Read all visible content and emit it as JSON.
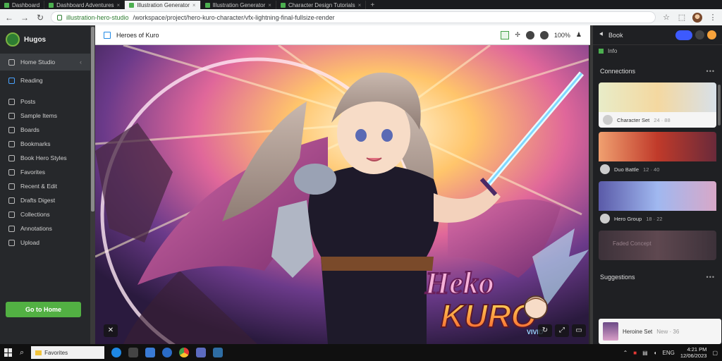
{
  "browser": {
    "tabs": [
      {
        "label": "Dashboard",
        "active": false
      },
      {
        "label": "Dashboard Adventures",
        "active": false
      },
      {
        "label": "Illustration Generator",
        "active": true
      },
      {
        "label": "Illustration Generator",
        "active": false
      },
      {
        "label": "Character Design Tutorials",
        "active": false
      }
    ],
    "new_tab": "+",
    "url_host": "illustration-hero-studio",
    "url_path": "/workspace/project/hero-kuro-character/vfx-lightning-final-fullsize-render",
    "nav": {
      "back": "←",
      "forward": "→",
      "reload": "↻"
    },
    "toolbar_icons": [
      "star-icon",
      "extension-icon",
      "profile-avatar"
    ]
  },
  "sidebar": {
    "brand": "Hugos",
    "items": [
      {
        "label": "Home Studio",
        "icon": "home-icon",
        "active": true
      },
      {
        "label": "Reading",
        "icon": "bookmark-icon",
        "accent": true
      },
      {
        "label": "Posts",
        "icon": "pen-icon"
      },
      {
        "label": "Sample Items",
        "icon": "link-icon"
      },
      {
        "label": "Boards",
        "icon": "board-icon"
      },
      {
        "label": "Bookmarks",
        "icon": "image-icon"
      },
      {
        "label": "Book Hero Styles",
        "icon": "book-icon"
      },
      {
        "label": "Favorites",
        "icon": "folder-icon"
      },
      {
        "label": "Recent & Edit",
        "icon": "clock-icon"
      },
      {
        "label": "Drafts Digest",
        "icon": "draft-icon"
      },
      {
        "label": "Collections",
        "icon": "collection-icon"
      },
      {
        "label": "Annotations",
        "icon": "note-icon"
      },
      {
        "label": "Upload",
        "icon": "upload-icon"
      }
    ],
    "cta_label": "Go to Home"
  },
  "viewer": {
    "title": "Heroes of Kuro",
    "toolbar_right_label": "100%",
    "art_title_line1": "Heko",
    "art_title_line2": "KURO",
    "art_badge": "VIVID",
    "bottom_controls": [
      "↻",
      "⤢",
      "▭"
    ],
    "left_control": "✕"
  },
  "right_panel": {
    "header_label": "Book",
    "sub_label": "Info",
    "section1_title": "Connections",
    "section2_title": "Suggestions",
    "more": "•••",
    "cards": [
      {
        "title": "Character Set",
        "meta": "24 · 88",
        "light": true
      },
      {
        "title": "Duo Battle",
        "meta": "12 · 40",
        "light": false
      },
      {
        "title": "Hero Group",
        "meta": "18 · 22",
        "light": false
      },
      {
        "title": "Faded Concept",
        "meta": "",
        "light": false
      }
    ],
    "suggestion": {
      "title": "Heroine Set",
      "meta": "New · 36"
    }
  },
  "taskbar": {
    "search_box": "Favorites",
    "apps": [
      "browser-app",
      "explorer-app",
      "store-app",
      "edge-app",
      "chrome-app",
      "mail-app",
      "settings-app"
    ],
    "tray_label": "ENG",
    "time": "4:21 PM",
    "date": "12/06/2023"
  },
  "colors": {
    "accent_green": "#52b043",
    "accent_blue": "#3d5afe",
    "sidebar_bg": "#26282b",
    "panel_bg": "#1f2023"
  }
}
